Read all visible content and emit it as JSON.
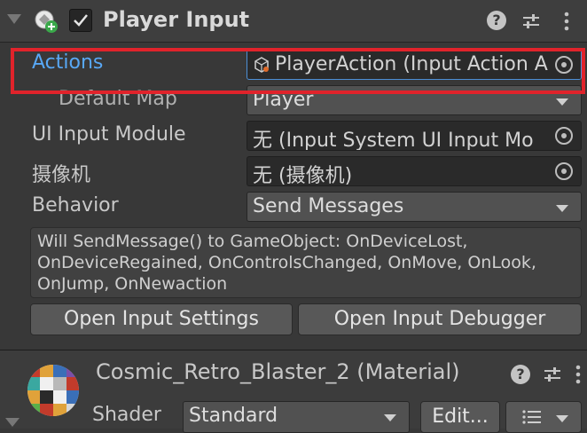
{
  "component": {
    "title": "Player Input",
    "enabled": true,
    "icons": [
      "script-icon",
      "help-icon",
      "preset-icon",
      "menu-icon"
    ]
  },
  "properties": {
    "actions": {
      "label": "Actions",
      "value": "PlayerAction (Input Action Asset)",
      "display": "PlayerAction (Input Action A"
    },
    "default_map": {
      "label": "Default Map",
      "value": "Player"
    },
    "ui_input_module": {
      "label": "UI Input Module",
      "value": "无 (Input System UI Input Mo"
    },
    "camera": {
      "label": "摄像机",
      "value": "无 (摄像机)"
    },
    "behavior": {
      "label": "Behavior",
      "value": "Send Messages"
    }
  },
  "helpbox": {
    "line1": "Will SendMessage() to GameObject: OnDeviceLost,",
    "line2": "OnDeviceRegained, OnControlsChanged, OnMove, OnLook,",
    "line3": "OnJump, OnNewaction"
  },
  "buttons": {
    "open_settings": "Open Input Settings",
    "open_debugger": "Open Input Debugger"
  },
  "material": {
    "title": "Cosmic_Retro_Blaster_2 (Material)",
    "shader_label": "Shader",
    "shader_value": "Standard",
    "edit_label": "Edit..."
  },
  "colors": {
    "highlight": "#e0232b",
    "actions_label": "#58a8f5",
    "panel_bg": "#383838"
  }
}
